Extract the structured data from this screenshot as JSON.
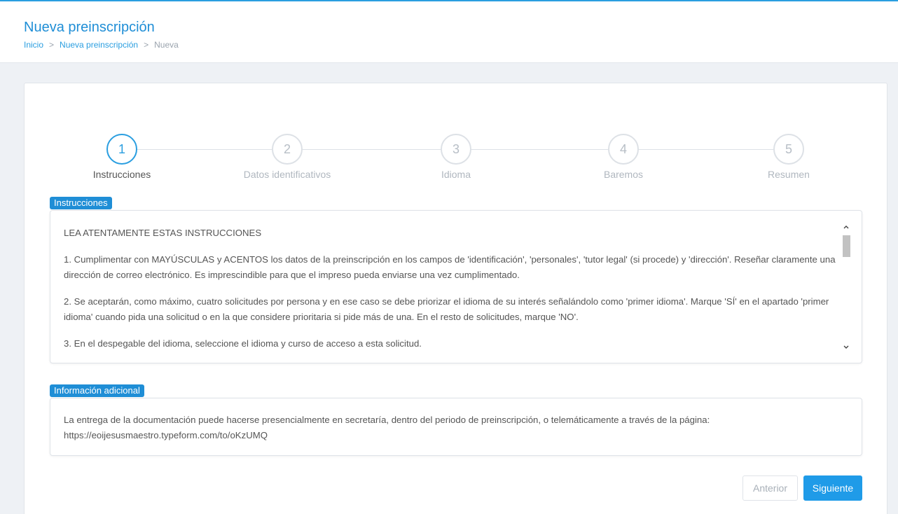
{
  "header": {
    "title": "Nueva preinscripción",
    "breadcrumb": [
      "Inicio",
      "Nueva preinscripción",
      "Nueva"
    ],
    "separator": ">"
  },
  "stepper": {
    "active_index": 0,
    "steps": [
      {
        "number": "1",
        "label": "Instrucciones"
      },
      {
        "number": "2",
        "label": "Datos identificativos"
      },
      {
        "number": "3",
        "label": "Idioma"
      },
      {
        "number": "4",
        "label": "Baremos"
      },
      {
        "number": "5",
        "label": "Resumen"
      }
    ]
  },
  "instructions": {
    "label": "Instrucciones",
    "heading": "LEA ATENTAMENTE ESTAS INSTRUCCIONES",
    "paragraphs": [
      "1. Cumplimentar con MAYÚSCULAS y ACENTOS los datos de la preinscripción en los campos de 'identificación', 'personales', 'tutor legal' (si procede) y 'dirección'. Reseñar claramente una dirección de correo electrónico. Es imprescindible para que el impreso pueda enviarse una vez cumplimentado.",
      "2. Se aceptarán, como máximo, cuatro solicitudes por persona y en ese caso se debe priorizar el idioma de su interés señalándolo como 'primer idioma'. Marque 'SÍ' en el apartado 'primer idioma' cuando pida una solicitud o en la que considere prioritaria si pide más de una. En el resto de solicitudes, marque 'NO'.",
      "3. En el despegable del idioma, seleccione el idioma y curso de acceso a esta solicitud."
    ],
    "scroll_up_icon": "chevron-up-icon",
    "scroll_down_icon": "chevron-down-icon"
  },
  "additional_info": {
    "label": "Información adicional",
    "text": "La entrega de la documentación puede hacerse presencialmente en secretaría, dentro del periodo de preinscripción, o telemáticamente a través de la página: https://eoijesusmaestro.typeform.com/to/oKzUMQ"
  },
  "buttons": {
    "prev": "Anterior",
    "next": "Siguiente"
  },
  "colors": {
    "accent": "#1f8ed6",
    "button_primary": "#1f9be8",
    "step_inactive": "#b7bec6"
  }
}
